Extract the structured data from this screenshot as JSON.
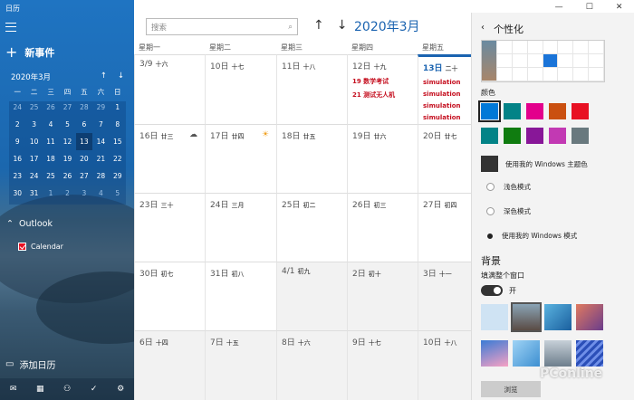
{
  "app": {
    "title": "日历"
  },
  "sidebar": {
    "new_event": "新事件",
    "mini_month": "2020年3月",
    "mini_weekdays": [
      "一",
      "二",
      "三",
      "四",
      "五",
      "六",
      "日"
    ],
    "mini_days": [
      [
        "24",
        "25",
        "26",
        "27",
        "28",
        "29",
        "1"
      ],
      [
        "2",
        "3",
        "4",
        "5",
        "6",
        "7",
        "8"
      ],
      [
        "9",
        "10",
        "11",
        "12",
        "13",
        "14",
        "15"
      ],
      [
        "16",
        "17",
        "18",
        "19",
        "20",
        "21",
        "22"
      ],
      [
        "23",
        "24",
        "25",
        "26",
        "27",
        "28",
        "29"
      ],
      [
        "30",
        "31",
        "1",
        "2",
        "3",
        "4",
        "5"
      ]
    ],
    "account": "Outlook",
    "calendar_name": "Calendar",
    "add_calendar": "添加日历",
    "bottom_icons": [
      "mail-icon",
      "calendar-icon",
      "people-icon",
      "todo-icon",
      "settings-icon"
    ]
  },
  "main": {
    "search_placeholder": "搜索",
    "month_title": "2020年3月",
    "weekdays": [
      "星期一",
      "星期二",
      "星期三",
      "星期四",
      "星期五"
    ],
    "weeks": [
      [
        {
          "d": "3/9",
          "l": "十六"
        },
        {
          "d": "10日",
          "l": "十七"
        },
        {
          "d": "11日",
          "l": "十八"
        },
        {
          "d": "12日",
          "l": "十九",
          "events": [
            "19 数学考试",
            "21 测试无人机"
          ]
        },
        {
          "d": "13日",
          "l": "二十",
          "today": true,
          "events": [
            "simulation",
            "simulation",
            "simulation",
            "simulation"
          ]
        }
      ],
      [
        {
          "d": "16日",
          "l": "廿三",
          "icon": "cloud"
        },
        {
          "d": "17日",
          "l": "廿四",
          "icon": "sun"
        },
        {
          "d": "18日",
          "l": "廿五"
        },
        {
          "d": "19日",
          "l": "廿六"
        },
        {
          "d": "20日",
          "l": "廿七"
        }
      ],
      [
        {
          "d": "23日",
          "l": "三十"
        },
        {
          "d": "24日",
          "l": "三月"
        },
        {
          "d": "25日",
          "l": "初二"
        },
        {
          "d": "26日",
          "l": "初三"
        },
        {
          "d": "27日",
          "l": "初四"
        }
      ],
      [
        {
          "d": "30日",
          "l": "初七"
        },
        {
          "d": "31日",
          "l": "初八"
        },
        {
          "d": "4/1",
          "l": "初九",
          "gray": true
        },
        {
          "d": "2日",
          "l": "初十",
          "gray": true
        },
        {
          "d": "3日",
          "l": "十一",
          "gray": true
        }
      ],
      [
        {
          "d": "6日",
          "l": "十四",
          "gray": true
        },
        {
          "d": "7日",
          "l": "十五",
          "gray": true
        },
        {
          "d": "8日",
          "l": "十六",
          "gray": true
        },
        {
          "d": "9日",
          "l": "十七",
          "gray": true
        },
        {
          "d": "10日",
          "l": "十八",
          "gray": true
        }
      ]
    ]
  },
  "panel": {
    "title": "个性化",
    "color_label": "颜色",
    "colors_row1": [
      "#0078d7",
      "#038387",
      "#e3008c",
      "#ca5010",
      "#e81123"
    ],
    "colors_row2": [
      "#038387",
      "#107c10",
      "#881798",
      "#c239b3",
      "#69797e"
    ],
    "use_theme_color": "使用我的 Windows 主题色",
    "modes": [
      "浅色模式",
      "深色模式",
      "使用我的 Windows 模式"
    ],
    "selected_mode": 2,
    "bg_title": "背景",
    "fill_label": "填满整个窗口",
    "toggle_state": "开",
    "browse": "浏览"
  },
  "watermark": "PConline"
}
